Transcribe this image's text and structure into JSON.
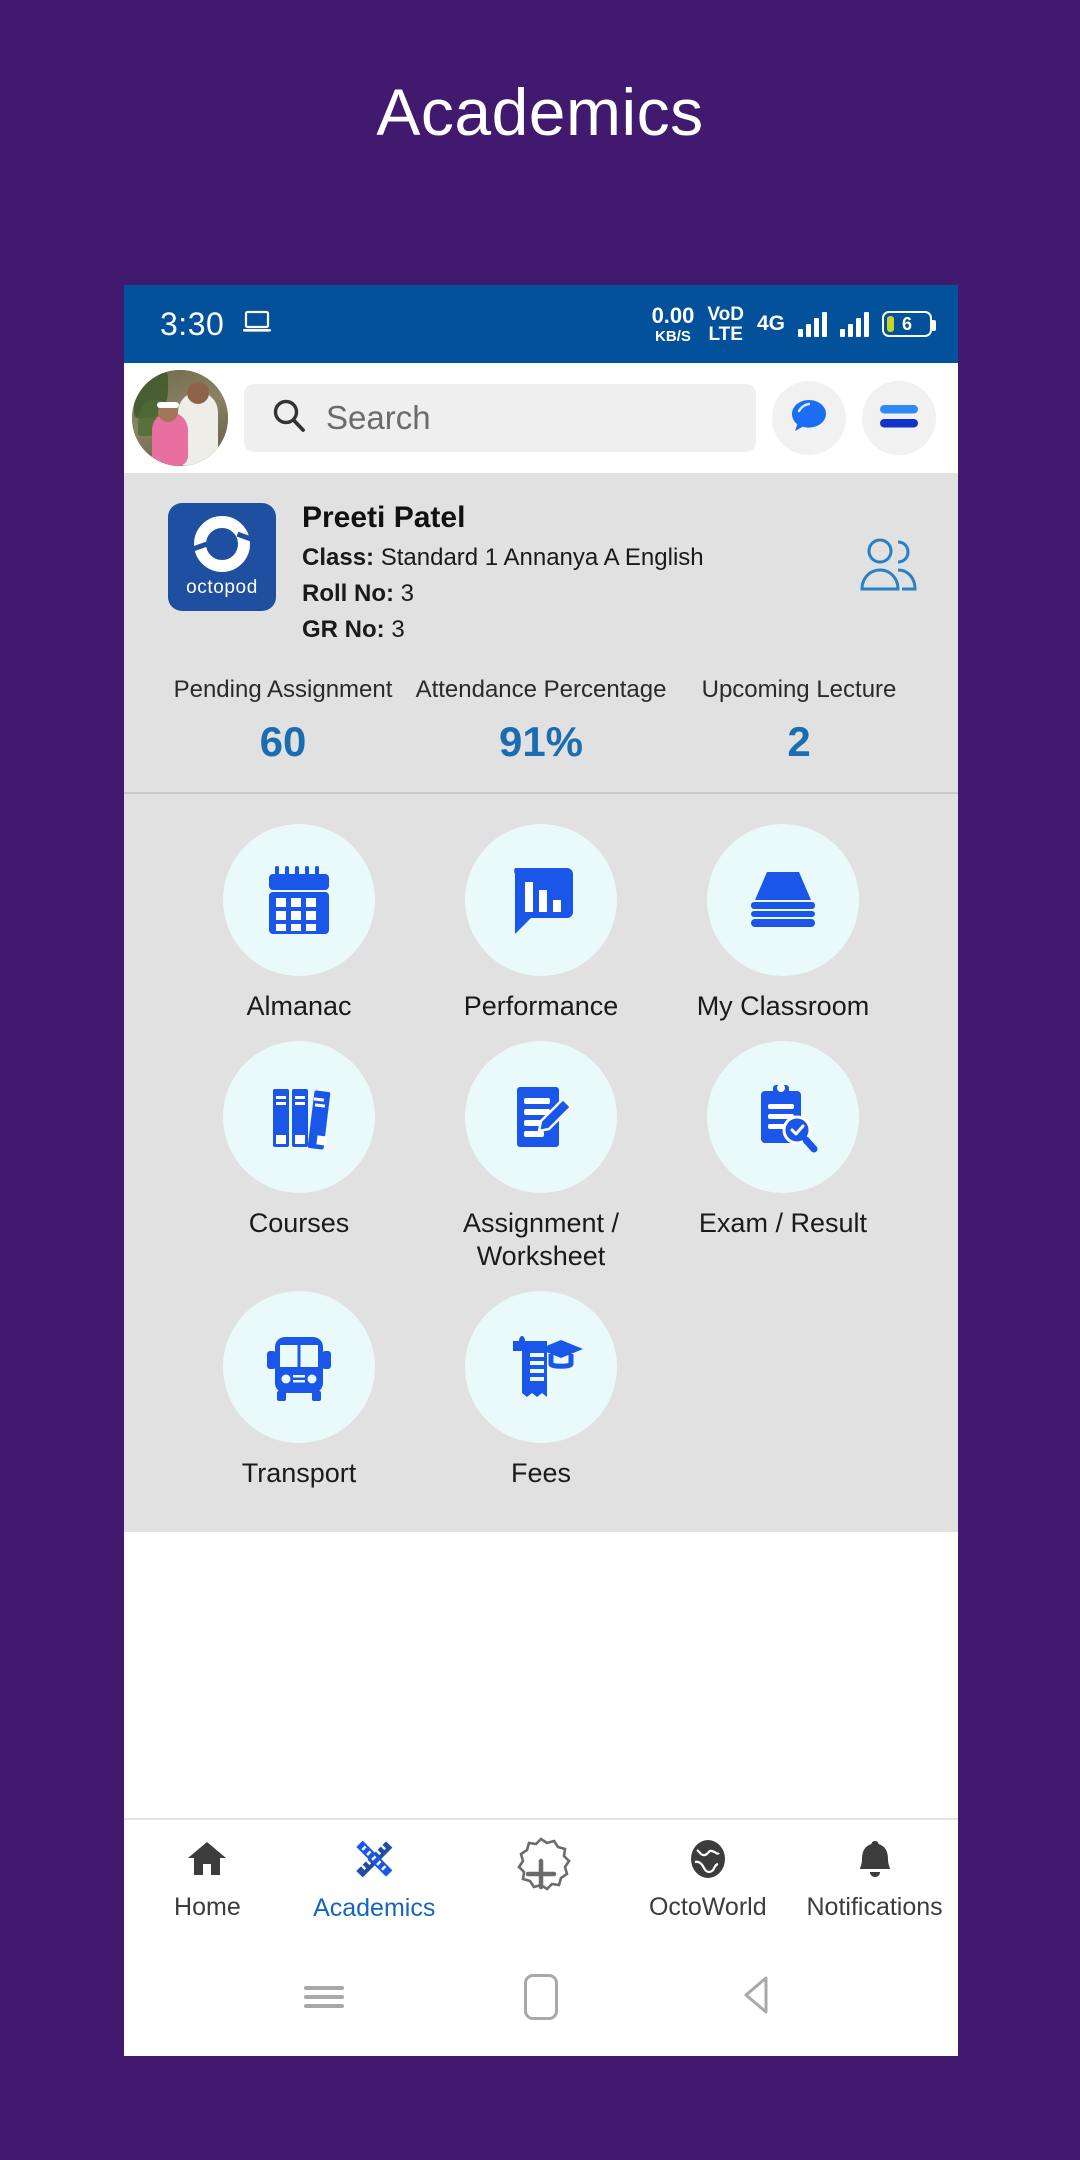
{
  "page": {
    "title": "Academics",
    "bg_color": "#411A70"
  },
  "statusbar": {
    "time": "3:30",
    "cast_icon": "laptop-icon",
    "data_speed_value": "0.00",
    "data_speed_unit": "KB/S",
    "volte_line1": "VoD",
    "volte_line2": "LTE",
    "network": "4G",
    "battery_level": "6",
    "bg_color": "#02519A"
  },
  "appbar": {
    "avatar_name": "profile-avatar",
    "search_placeholder": "Search",
    "search_value": "",
    "chat_icon": "chat-bubble-icon",
    "menu_icon": "menu-icon"
  },
  "student": {
    "logo_text": "octopod",
    "name": "Preeti Patel",
    "class_label": "Class:",
    "class_value": "Standard 1 Annanya A English",
    "roll_label": "Roll No:",
    "roll_value": "3",
    "gr_label": "GR No:",
    "gr_value": "3",
    "people_icon": "two-people-icon"
  },
  "stats": [
    {
      "label": "Pending Assignment",
      "value": "60"
    },
    {
      "label": "Attendance Percentage",
      "value": "91%"
    },
    {
      "label": "Upcoming Lecture",
      "value": "2"
    }
  ],
  "stat_color": "#1A6DB0",
  "grid": [
    {
      "label": "Almanac",
      "icon": "calendar-icon"
    },
    {
      "label": "Performance",
      "icon": "chat-bar-chart-icon"
    },
    {
      "label": "My Classroom",
      "icon": "books-stack-icon"
    },
    {
      "label": "Courses",
      "icon": "book-shelf-icon"
    },
    {
      "label": "Assignment / Worksheet",
      "icon": "document-pencil-icon"
    },
    {
      "label": "Exam / Result",
      "icon": "clipboard-search-icon"
    },
    {
      "label": "Transport",
      "icon": "bus-icon"
    },
    {
      "label": "Fees",
      "icon": "receipt-graduation-cap-icon"
    }
  ],
  "bottom_nav": {
    "items": [
      {
        "label": "Home",
        "icon": "home-icon",
        "active": false
      },
      {
        "label": "Academics",
        "icon": "ruler-pencil-icon",
        "active": true
      },
      {
        "label": "",
        "icon": "plus-badge-icon",
        "active": false
      },
      {
        "label": "OctoWorld",
        "icon": "globe-icon",
        "active": false
      },
      {
        "label": "Notifications",
        "icon": "bell-icon",
        "active": false
      }
    ],
    "active_color": "#1565C0"
  },
  "android_nav": {
    "recents_icon": "recents-icon",
    "home_icon": "home-square-icon",
    "back_icon": "back-triangle-icon"
  }
}
